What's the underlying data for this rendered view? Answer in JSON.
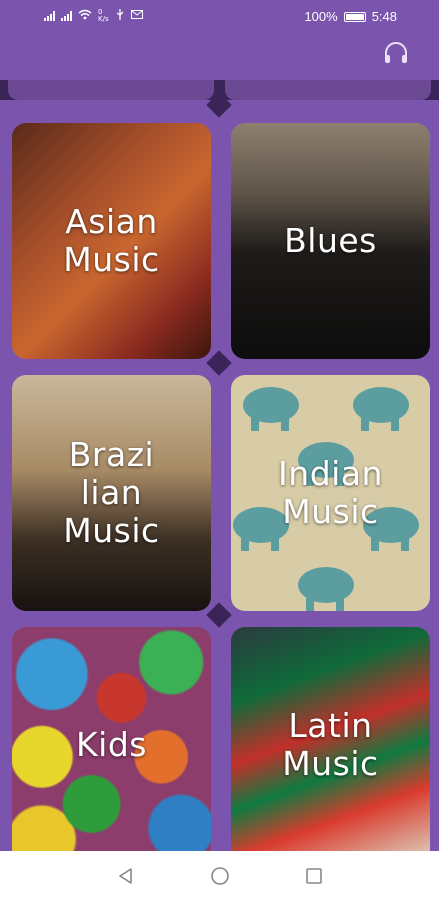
{
  "status_bar": {
    "battery_percent": "100%",
    "time": "5:48",
    "data_speed_value": "0",
    "data_speed_unit": "K/s"
  },
  "app_bar": {
    "headphones_icon": "headphones-icon"
  },
  "genres": [
    {
      "label": "Asian\nMusic"
    },
    {
      "label": "Blues"
    },
    {
      "label": "Brazi\nlian\nMusic"
    },
    {
      "label": "Indian\nMusic"
    },
    {
      "label": "Kids"
    },
    {
      "label": "Latin\nMusic"
    }
  ],
  "colors": {
    "accent": "#7b55ad",
    "background": "#3a2458",
    "nav_bar": "#ffffff",
    "nav_icon": "#888888"
  },
  "nav": {
    "back_icon": "triangle-back-icon",
    "home_icon": "circle-home-icon",
    "recents_icon": "square-recents-icon"
  }
}
